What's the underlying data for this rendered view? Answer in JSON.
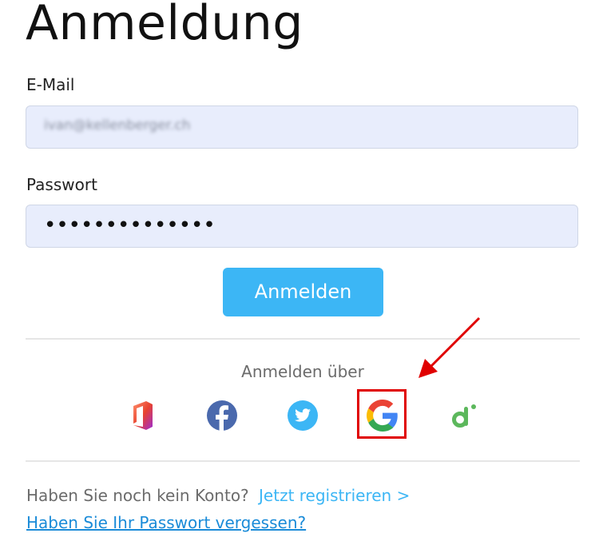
{
  "page": {
    "title": "Anmeldung"
  },
  "form": {
    "email_label": "E-Mail",
    "email_value": "ivan@kellenberger.ch",
    "password_label": "Passwort",
    "password_value": "••••••••••••••",
    "submit_label": "Anmelden"
  },
  "social": {
    "heading": "Anmelden über",
    "providers": [
      {
        "name": "office-icon",
        "color": "#d83b01"
      },
      {
        "name": "facebook-icon",
        "color": "#4a69ad"
      },
      {
        "name": "twitter-icon",
        "color": "#3cb6f5"
      },
      {
        "name": "google-icon",
        "color": "#4285f4",
        "highlighted": true
      },
      {
        "name": "other-provider-icon",
        "color": "#5cb85c"
      }
    ],
    "highlight_color": "#e00000"
  },
  "footer": {
    "no_account_text": "Haben Sie noch kein Konto?",
    "register_link": "Jetzt registrieren >",
    "forgot_link": "Haben Sie Ihr Passwort vergessen?"
  },
  "colors": {
    "accent": "#3cb6f5",
    "input_bg": "#e8edfc"
  }
}
